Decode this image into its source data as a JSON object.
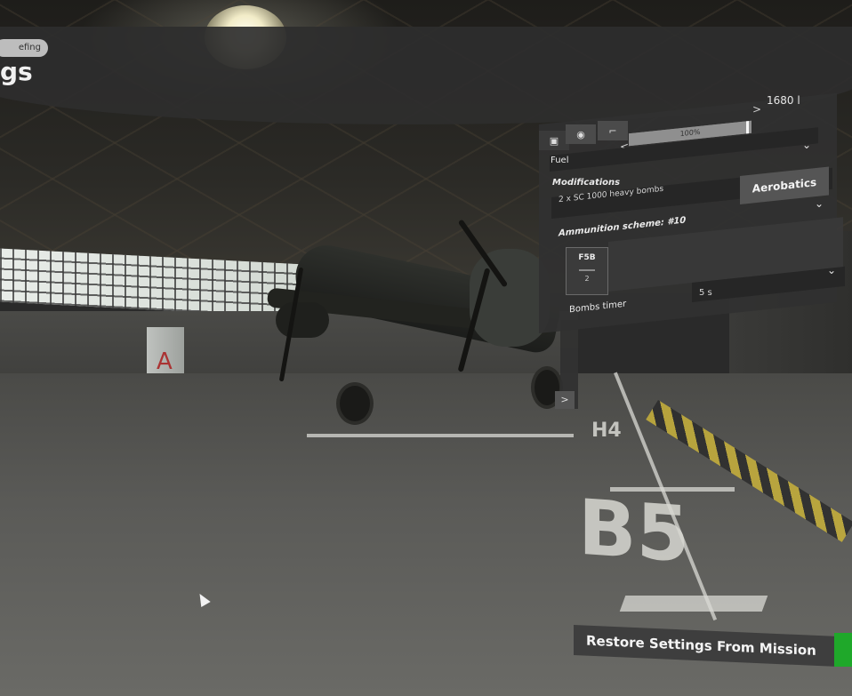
{
  "header": {
    "tab_label": "efing",
    "title": "gs"
  },
  "panel": {
    "tabs": [
      {
        "icon": "plane-icon",
        "glyph": "▣"
      },
      {
        "icon": "camera-icon",
        "glyph": "◉"
      },
      {
        "icon": "gun-icon",
        "glyph": "⌐"
      }
    ],
    "fuel": {
      "label": "Fuel",
      "percent_text": "100%",
      "percent": 100,
      "value": "1680 l",
      "left_arrow": "<",
      "right_arrow": ">"
    },
    "modifications": {
      "label": "Modifications",
      "selected": "2 x SC 1000 heavy bombs",
      "aerobatics_label": "Aerobatics"
    },
    "ammunition": {
      "label": "Ammunition scheme: #10",
      "card_title": "F5B",
      "card_count": "2"
    },
    "bombs_timer": {
      "label": "Bombs timer",
      "value": "5 s"
    }
  },
  "floor_markings": {
    "bay_1": "H4",
    "bay_2": "B5"
  },
  "pillar_letter": "A",
  "restore_button": {
    "label": "Restore Settings From Mission",
    "accent": "#1fa82a"
  }
}
